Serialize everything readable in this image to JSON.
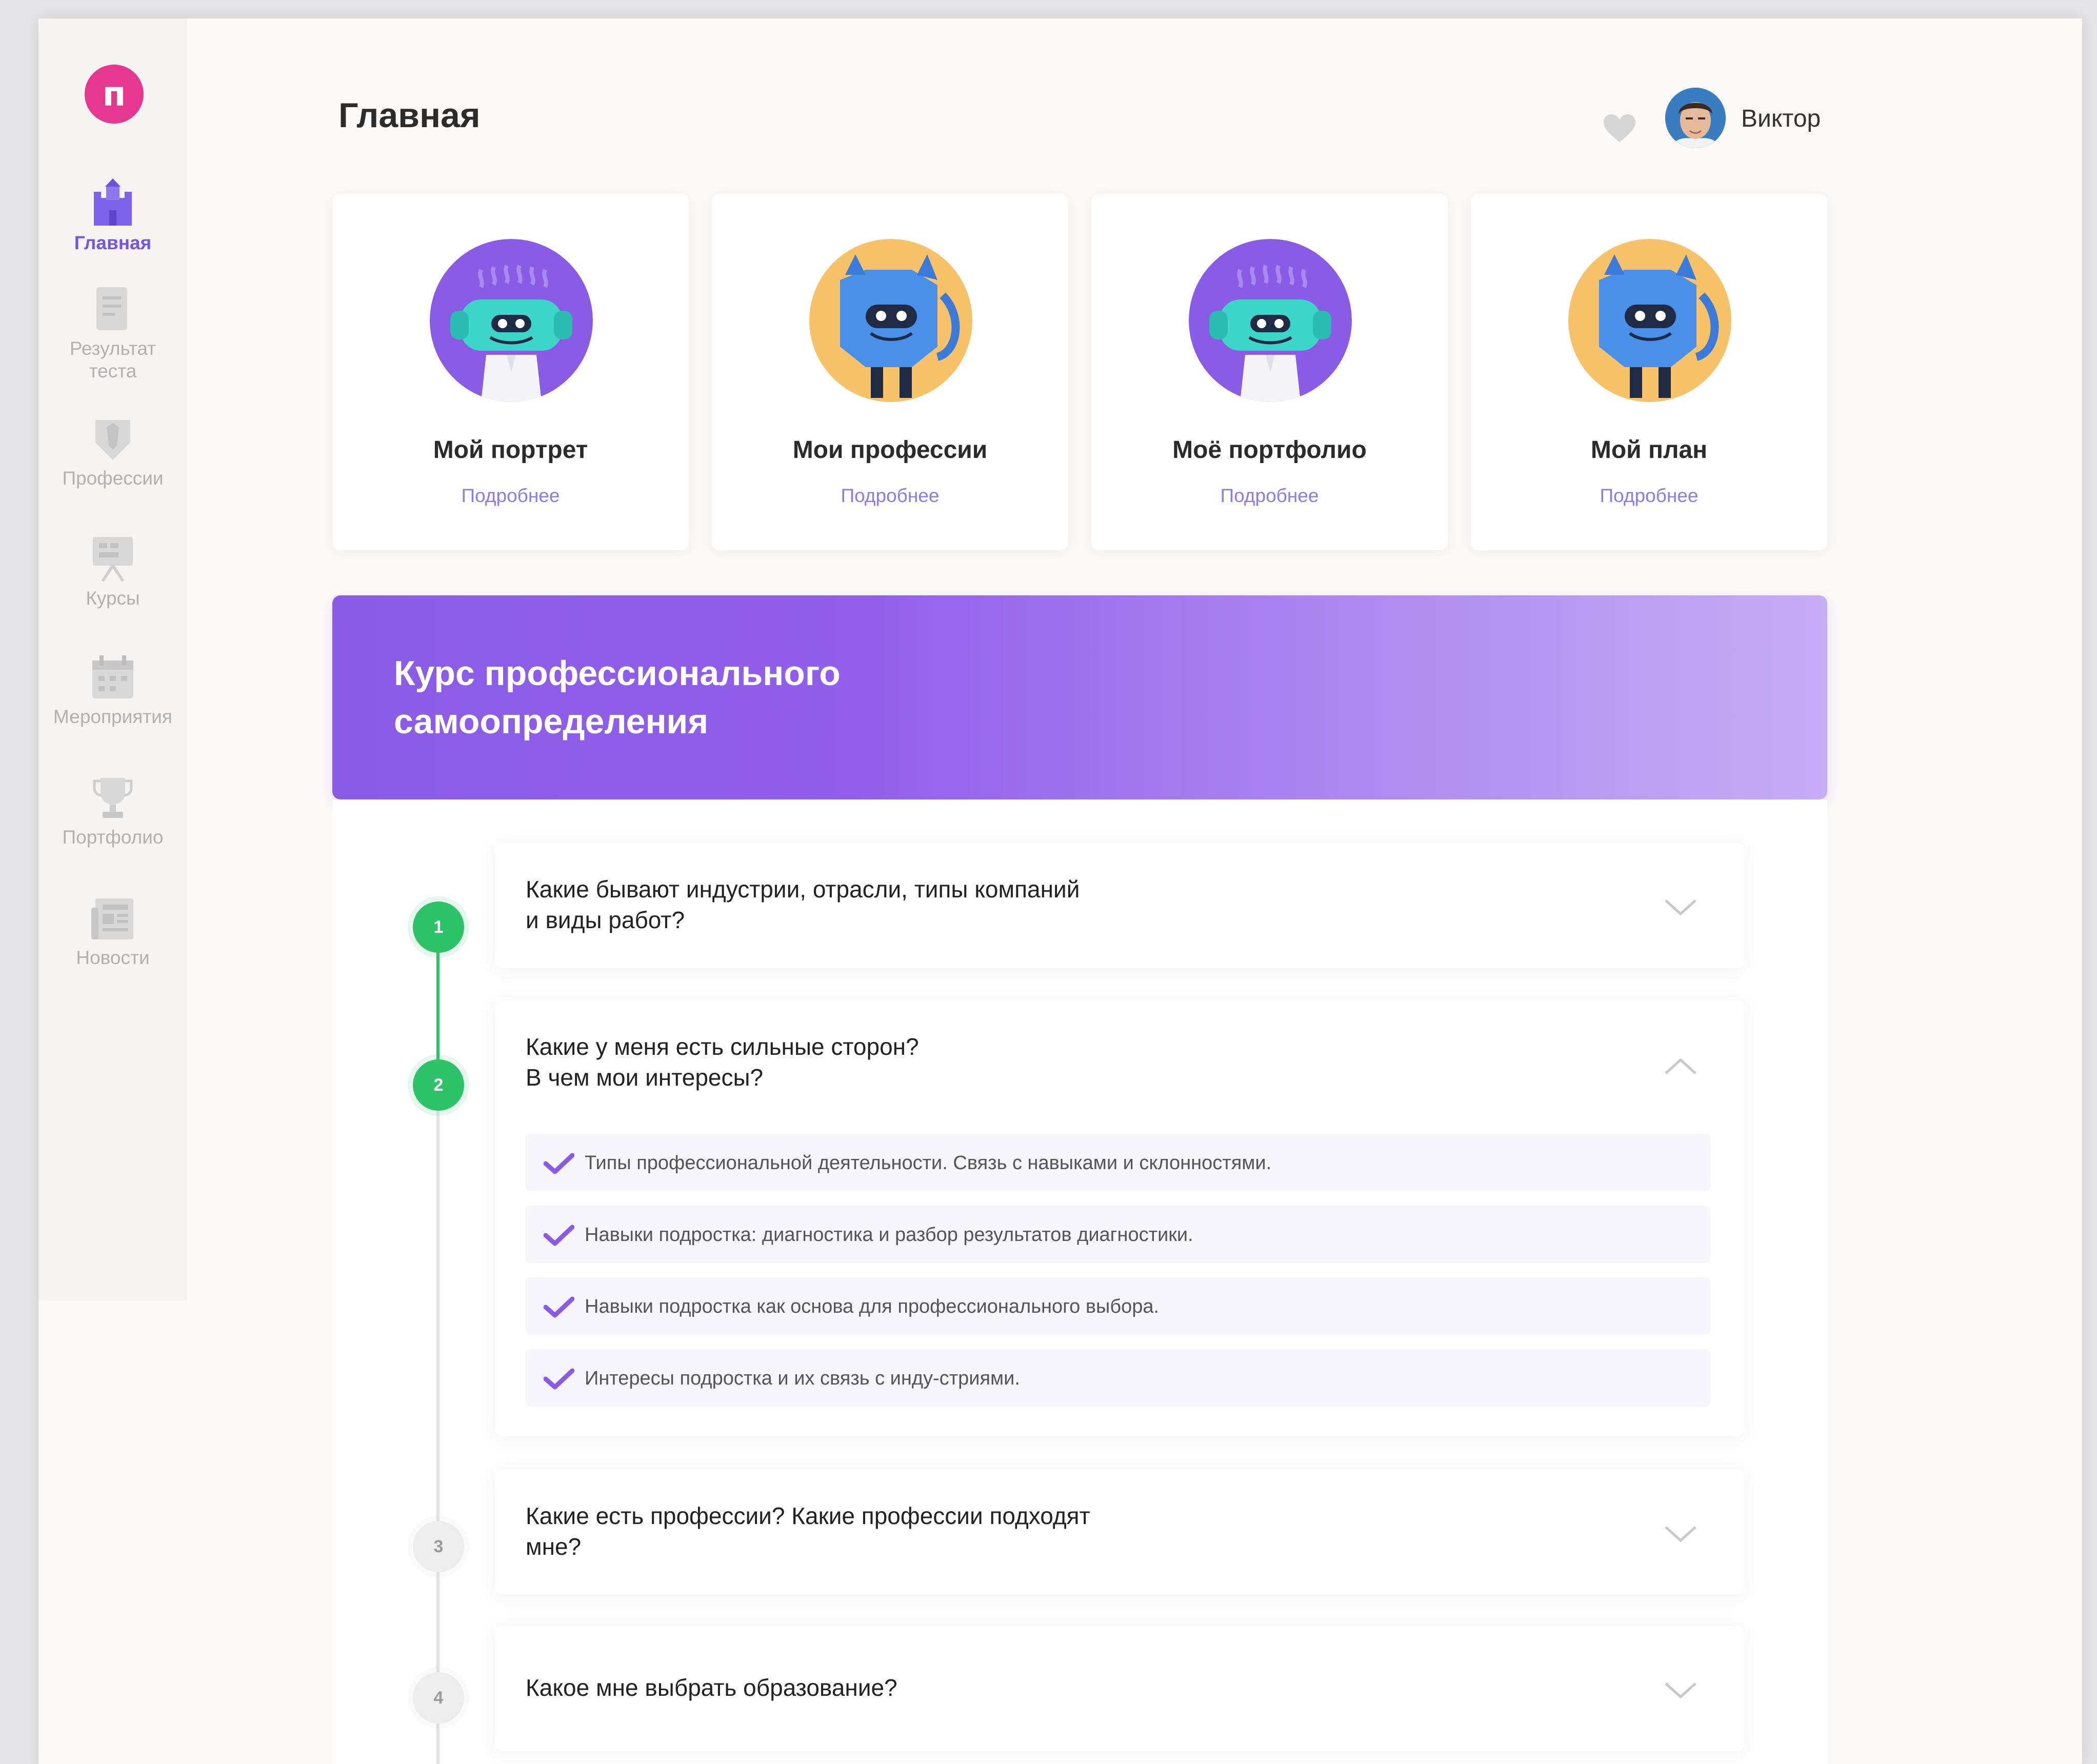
{
  "app": {
    "logo_letter": "п"
  },
  "sidebar": {
    "items": [
      {
        "label": "Главная",
        "active": true,
        "icon": "castle-icon"
      },
      {
        "label": "Результат\nтеста",
        "active": false,
        "icon": "document-icon"
      },
      {
        "label": "Профессии",
        "active": false,
        "icon": "badge-icon"
      },
      {
        "label": "Курсы",
        "active": false,
        "icon": "easel-icon"
      },
      {
        "label": "Мероприятия",
        "active": false,
        "icon": "calendar-icon"
      },
      {
        "label": "Портфолио",
        "active": false,
        "icon": "trophy-icon"
      },
      {
        "label": "Новости",
        "active": false,
        "icon": "newspaper-icon"
      }
    ]
  },
  "header": {
    "title": "Главная",
    "favorites_icon": "heart-icon",
    "user_name": "Виктор"
  },
  "cards": [
    {
      "title": "Мой портрет",
      "link": "Подробнее",
      "mascot": "purple-mascot"
    },
    {
      "title": "Мои профессии",
      "link": "Подробнее",
      "mascot": "blue-cat-mascot"
    },
    {
      "title": "Моё портфолио",
      "link": "Подробнее",
      "mascot": "purple-mascot"
    },
    {
      "title": "Мой план",
      "link": "Подробнее",
      "mascot": "blue-cat-mascot"
    }
  ],
  "banner": {
    "title": "Курс профессионального самоопределения"
  },
  "course": {
    "steps": [
      {
        "number": "1",
        "status": "done",
        "title": "Какие бывают индустрии, отрасли, типы компаний\nи виды работ?",
        "expanded": false
      },
      {
        "number": "2",
        "status": "done",
        "title": "Какие у меня есть сильные сторон?\nВ чем мои интересы?",
        "expanded": true,
        "subitems": [
          "Типы профессиональной деятельности. Связь с навыками и склонностями.",
          "Навыки подростка: диагностика и разбор результатов диагностики.",
          "Навыки подростка как основа для профессионального выбора.",
          "Интересы подростка и их связь с инду-стриями."
        ]
      },
      {
        "number": "3",
        "status": "todo",
        "title": "Какие есть профессии? Какие профессии подходят\nмне?",
        "expanded": false
      },
      {
        "number": "4",
        "status": "todo",
        "title": "Какое мне выбрать образование?",
        "expanded": false
      }
    ]
  },
  "colors": {
    "accent": "#6f58e4",
    "logo": "#e5378e",
    "done": "#2ec368",
    "banner_start": "#8a5ce6",
    "banner_end": "#c4aef4"
  }
}
